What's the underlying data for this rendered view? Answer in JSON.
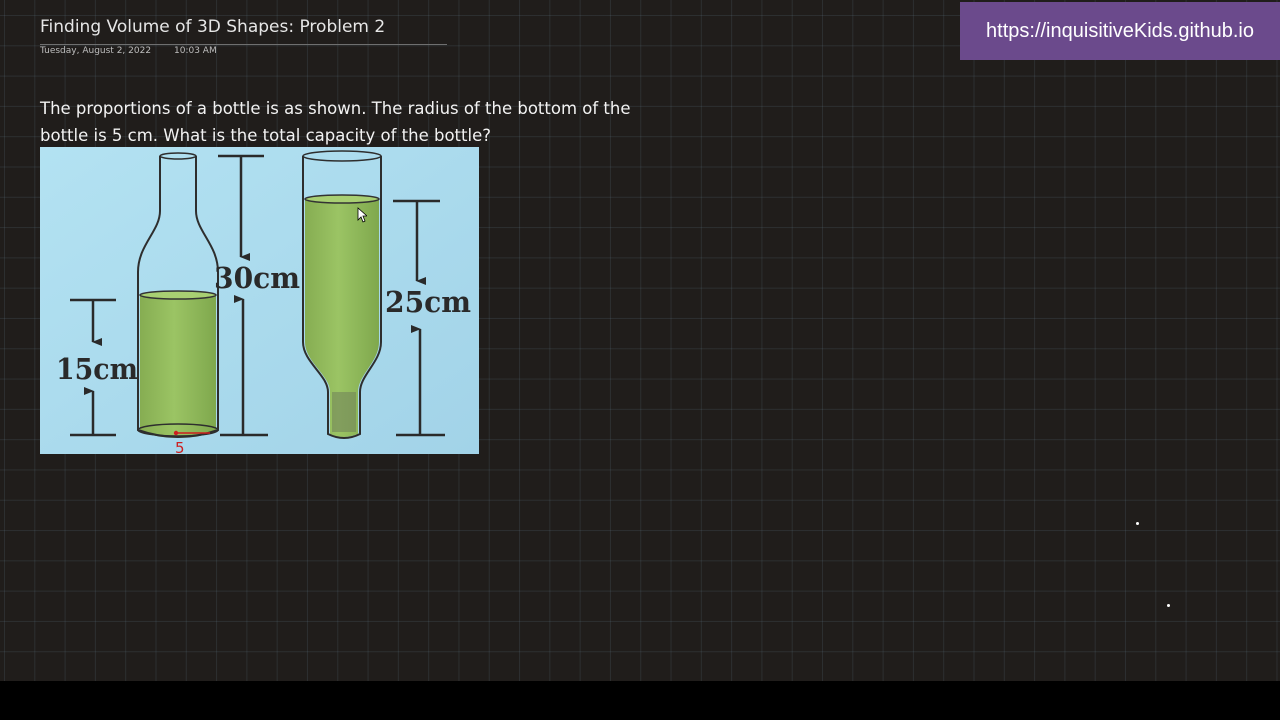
{
  "page": {
    "title": "Finding Volume of 3D Shapes: Problem 2",
    "date": "Tuesday, August 2, 2022",
    "time": "10:03 AM",
    "question": "The proportions of a bottle is as shown. The radius of the bottom of the bottle is 5 cm. What is the total capacity of the bottle?"
  },
  "badge": {
    "url": "https://inquisitiveKids.github.io"
  },
  "figure": {
    "label_15": "15cm",
    "label_30": "30cm",
    "label_25": "25cm",
    "annotation": "5"
  },
  "colors": {
    "background": "#201d1b",
    "badge": "#6b4a8c",
    "figure_background": "#a9d9ec",
    "liquid": "#8fb85a",
    "annotation": "#cc1f1f"
  },
  "icons": [
    "mouse-cursor-icon"
  ]
}
